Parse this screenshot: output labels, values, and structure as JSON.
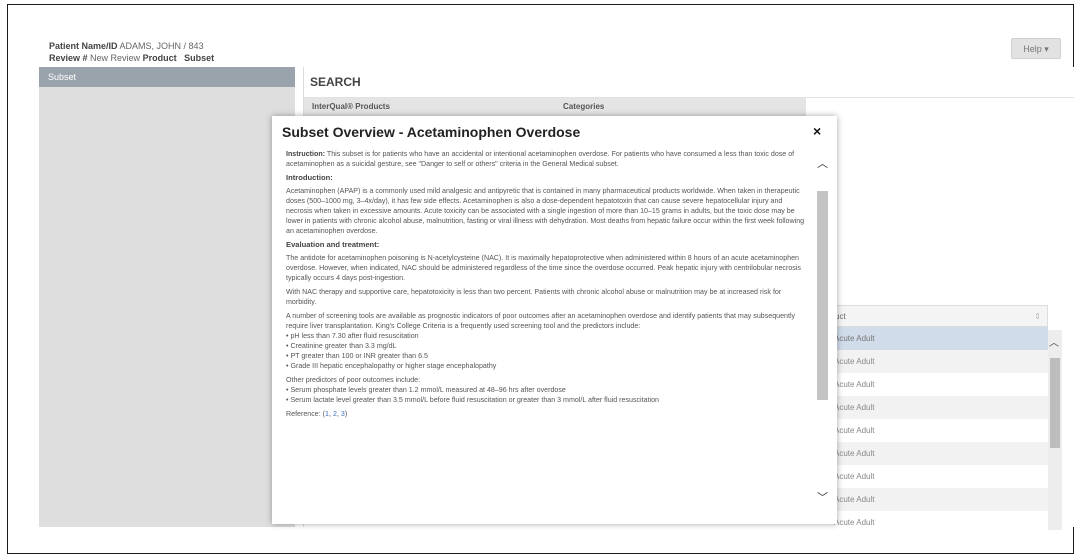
{
  "header": {
    "patient_label": "Patient Name/ID",
    "patient_value": "ADAMS, JOHN / 843",
    "review_label": "Review #",
    "review_value": "New Review",
    "product_label": "Product",
    "subset_label": "Subset",
    "help_label": "Help ▾"
  },
  "sidebar": {
    "items": [
      {
        "label": "Subset"
      }
    ]
  },
  "search": {
    "title": "SEARCH",
    "products_header": "InterQual® Products",
    "categories_header": "Categories"
  },
  "table": {
    "header": "uct",
    "rows": [
      "Acute Adult",
      "Acute Adult",
      "Acute Adult",
      "Acute Adult",
      "Acute Adult",
      "Acute Adult",
      "Acute Adult",
      "Acute Adult",
      "Acute Adult"
    ]
  },
  "modal": {
    "title": "Subset Overview - Acetaminophen Overdose",
    "close": "×",
    "instruction_label": "Instruction:",
    "instruction_text": "This subset is for patients who have an accidental or intentional acetaminophen overdose. For patients who have consumed a less than toxic dose of acetaminophen as a suicidal gesture, see \"Danger to self or others\" criteria in the General Medical subset.",
    "intro_heading": "Introduction:",
    "intro_text": "Acetaminophen (APAP) is a commonly used mild analgesic and antipyretic that is contained in many pharmaceutical products worldwide. When taken in therapeutic doses (500–1000 mg, 3–4x/day), it has few side effects. Acetaminophen is also a dose-dependent hepatotoxin that can cause severe hepatocellular injury and necrosis when taken in excessive amounts. Acute toxicity can be associated with a single ingestion of more than 10–15 grams in adults, but the toxic dose may be lower in patients with chronic alcohol abuse, malnutrition, fasting or viral illness with dehydration. Most deaths from hepatic failure occur within the first week following an acetaminophen overdose.",
    "eval_heading": "Evaluation and treatment:",
    "eval_text1": "The antidote for acetaminophen poisoning is N-acetylcysteine (NAC). It is maximally hepatoprotective when administered within 8 hours of an acute acetaminophen overdose. However, when indicated, NAC should be administered regardless of the time since the overdose occurred. Peak hepatic injury with centrilobular necrosis typically occurs 4 days post-ingestion.",
    "eval_text2": "With NAC therapy and supportive care, hepatotoxicity is less than two percent. Patients with chronic alcohol abuse or malnutrition may be at increased risk for morbidity.",
    "eval_text3": "A number of screening tools are available as prognostic indicators of poor outcomes after an acetaminophen overdose and identify patients that may subsequently require liver transplantation. King's College Criteria is a frequently used screening tool and the predictors include:",
    "predictors": [
      "• pH less than 7.30 after fluid resuscitation",
      "• Creatinine greater than 3.3 mg/dL",
      "• PT greater than 100 or INR greater than 6.5",
      "• Grade III hepatic encephalopathy or higher stage encephalopathy"
    ],
    "other_heading": "Other predictors of poor outcomes include:",
    "other_predictors": [
      "• Serum phosphate levels greater than 1.2 mmol/L measured at 48–96 hrs after overdose",
      "• Serum lactate level greater than 3.5 mmol/L before fluid resuscitation or greater than 3 mmol/L after fluid resuscitation"
    ],
    "reference_label": "Reference: (",
    "ref_links": [
      "1",
      "2",
      "3"
    ],
    "reference_close": ")"
  }
}
